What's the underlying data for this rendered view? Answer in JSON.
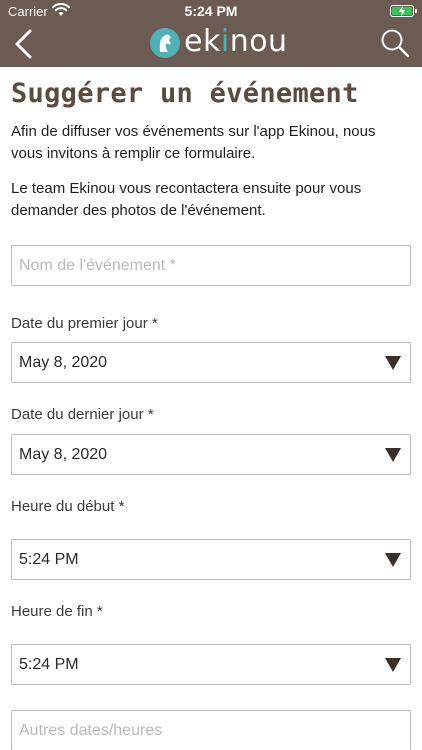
{
  "status_bar": {
    "carrier": "Carrier",
    "time": "5:24 PM"
  },
  "brand": {
    "name_prefix": "ek",
    "name_accent": "i",
    "name_suffix": "nou",
    "accent_color": "#4fb1b6",
    "bar_color": "#6b5b52"
  },
  "page": {
    "title": "Suggérer un événement",
    "intro_1": "Afin de diffuser vos événements sur l'app Ekinou, nous vous invitons à remplir ce formulaire.",
    "intro_2": "Le team Ekinou vous recontactera ensuite pour vous demander des photos de l'événement."
  },
  "form": {
    "event_name_placeholder": "Nom de l'événement *",
    "first_day_label": "Date du premier jour *",
    "first_day_value": "May 8, 2020",
    "last_day_label": "Date du dernier jour *",
    "last_day_value": "May 8, 2020",
    "start_time_label": "Heure du début *",
    "start_time_value": "5:24 PM",
    "end_time_label": "Heure de fin *",
    "end_time_value": "5:24 PM",
    "other_dates_placeholder": "Autres dates/heures"
  },
  "icons": {
    "back": "chevron-left-icon",
    "search": "search-icon",
    "dropdown": "triangle-down-icon"
  }
}
